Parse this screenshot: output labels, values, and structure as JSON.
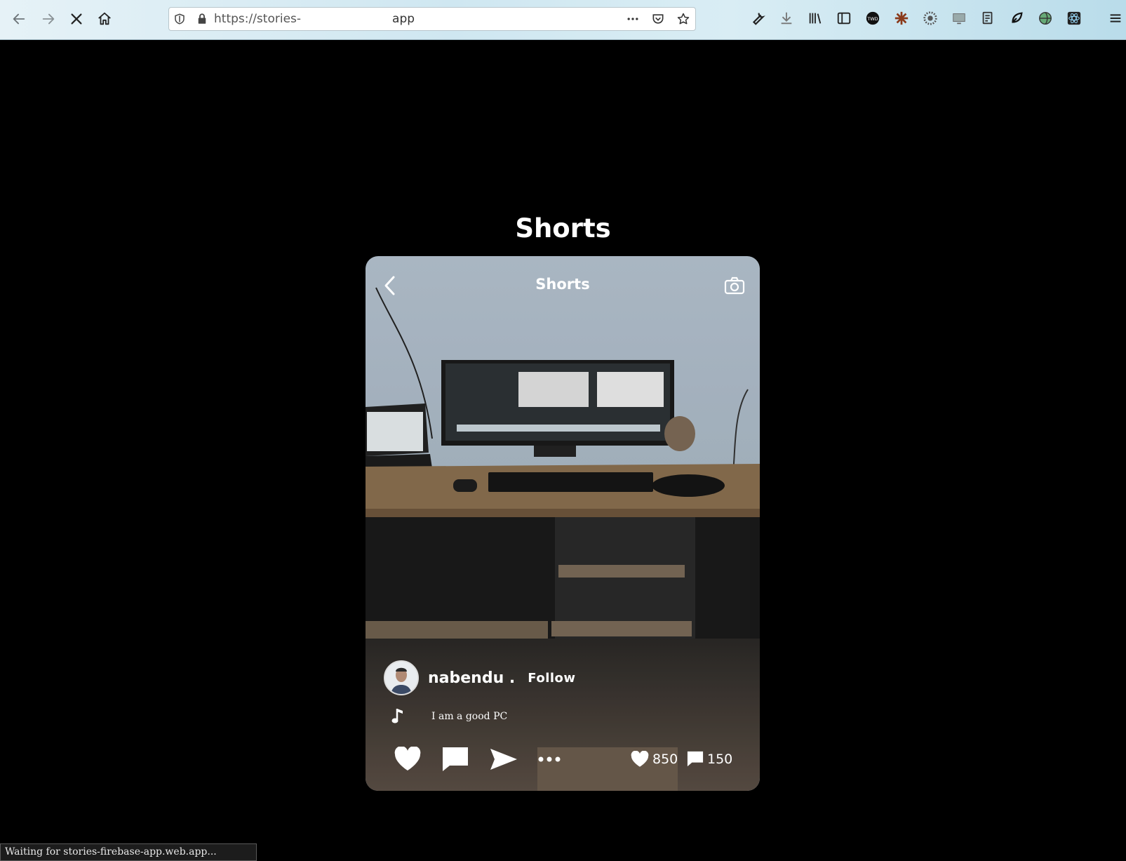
{
  "browser": {
    "url_prefix": "https://stories-",
    "url_suffix": "app",
    "status_text": "Waiting for stories-firebase-app.web.app..."
  },
  "page": {
    "title": "Shorts"
  },
  "short": {
    "header_title": "Shorts",
    "username": "nabendu .",
    "follow_label": "Follow",
    "song": "I am a good PC",
    "likes": "850",
    "comments": "150"
  },
  "colors": {
    "page_background": "#000000",
    "text": "#ffffff",
    "wall": "#a9b7c4",
    "desk": "#8a6f4f",
    "floor": "#3b3530"
  }
}
